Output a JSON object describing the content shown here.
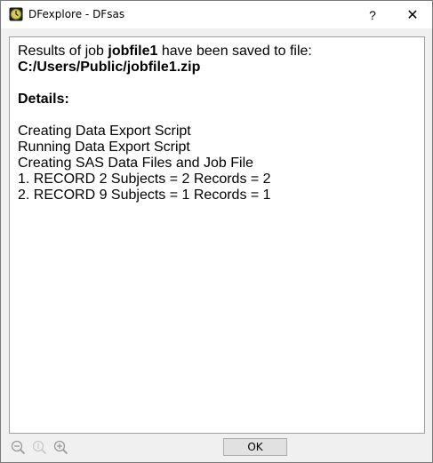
{
  "window": {
    "title": "DFexplore - DFsas",
    "help_label": "?",
    "close_label": "✕"
  },
  "message": {
    "intro_prefix": "Results of job ",
    "job_name": "jobfile1",
    "intro_suffix": " have been saved to file:",
    "file_path": "C:/Users/Public/jobfile1.zip",
    "details_heading": "Details:",
    "details": [
      "Creating Data Export Script",
      "Running Data Export Script",
      "Creating SAS Data Files and Job File",
      "1. RECORD 2 Subjects = 2 Records = 2",
      "2. RECORD 9 Subjects = 1 Records = 1"
    ]
  },
  "footer": {
    "zoom_icons": [
      "zoom-out-icon",
      "zoom-reset-icon",
      "zoom-in-icon"
    ],
    "ok_label": "OK"
  },
  "colors": {
    "icon_green": "#7a9a2a",
    "icon_gray": "#9a9a9a",
    "icon_disabled": "#c8c8c8"
  }
}
